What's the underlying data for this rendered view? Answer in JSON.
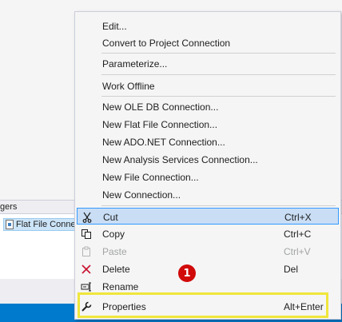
{
  "background": {
    "panel_tab_label": "gers",
    "panel_item_label": "Flat File Connection"
  },
  "menu": {
    "items": [
      {
        "label": "Edit...",
        "shortcut": ""
      },
      {
        "label": "Convert to Project Connection",
        "shortcut": ""
      },
      {
        "label": "Parameterize...",
        "shortcut": ""
      },
      {
        "label": "Work Offline",
        "shortcut": ""
      },
      {
        "label": "New OLE DB Connection...",
        "shortcut": ""
      },
      {
        "label": "New Flat File Connection...",
        "shortcut": ""
      },
      {
        "label": "New ADO.NET Connection...",
        "shortcut": ""
      },
      {
        "label": "New Analysis Services Connection...",
        "shortcut": ""
      },
      {
        "label": "New File Connection...",
        "shortcut": ""
      },
      {
        "label": "New Connection...",
        "shortcut": ""
      },
      {
        "label": "Cut",
        "shortcut": "Ctrl+X",
        "icon": "scissors-icon",
        "highlighted": true
      },
      {
        "label": "Copy",
        "shortcut": "Ctrl+C",
        "icon": "copy-icon"
      },
      {
        "label": "Paste",
        "shortcut": "Ctrl+V",
        "icon": "paste-icon",
        "disabled": true
      },
      {
        "label": "Delete",
        "shortcut": "Del",
        "icon": "delete-icon"
      },
      {
        "label": "Rename",
        "shortcut": "",
        "icon": "rename-icon"
      },
      {
        "label": "Properties",
        "shortcut": "Alt+Enter",
        "icon": "wrench-icon"
      }
    ]
  },
  "annotation": {
    "callout_number": "1",
    "callout_color": "#d10a0a",
    "outline_color": "#f0e63c"
  },
  "colors": {
    "highlight_bg": "#c9def5",
    "highlight_border": "#3399ff",
    "status_bar": "#007acc"
  }
}
